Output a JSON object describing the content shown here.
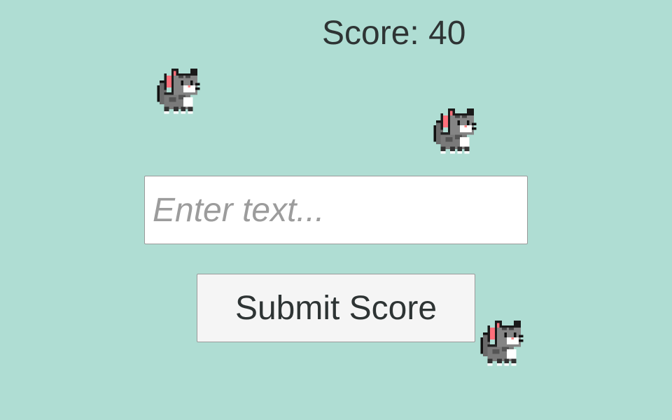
{
  "hud": {
    "score_text": "Score: 40"
  },
  "form": {
    "input_value": "",
    "input_placeholder": "Enter text...",
    "submit_label": "Submit Score"
  },
  "sprites": [
    {
      "icon": "pixel-cat-icon"
    },
    {
      "icon": "pixel-cat-icon"
    },
    {
      "icon": "pixel-cat-icon"
    }
  ],
  "colors": {
    "background": "#afddd3",
    "text": "#2e3434",
    "button_bg": "#f5f5f5",
    "input_bg": "#ffffff"
  }
}
